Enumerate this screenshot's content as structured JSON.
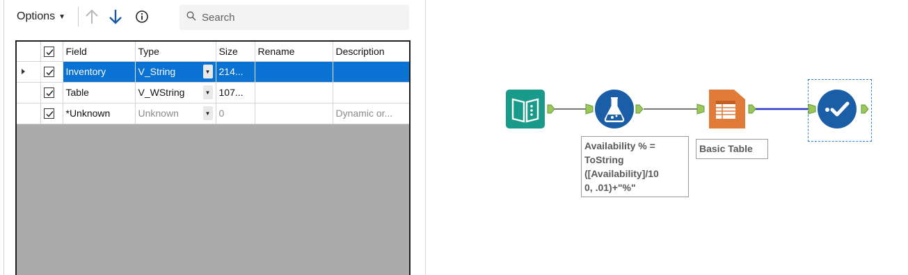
{
  "toolbar": {
    "options_label": "Options",
    "search_placeholder": "Search"
  },
  "grid": {
    "columns": [
      "Field",
      "Type",
      "Size",
      "Rename",
      "Description"
    ],
    "rows": [
      {
        "selected": true,
        "checked": true,
        "field": "Inventory",
        "type": "V_String",
        "size": "214...",
        "rename": "",
        "description": ""
      },
      {
        "selected": false,
        "checked": true,
        "field": "Table",
        "type": "V_WString",
        "size": "107...",
        "rename": "",
        "description": ""
      },
      {
        "selected": false,
        "checked": true,
        "field": "*Unknown",
        "type": "Unknown",
        "size": "0",
        "rename": "",
        "description": "Dynamic or..."
      }
    ]
  },
  "workflow": {
    "tools": [
      {
        "name": "input-data-tool",
        "icon": "book-icon",
        "color": "#1a9a8a"
      },
      {
        "name": "formula-tool",
        "icon": "flask-icon",
        "color": "#1b5ea8"
      },
      {
        "name": "basic-table-tool",
        "icon": "table-icon",
        "color": "#e07b39"
      },
      {
        "name": "render-tool",
        "icon": "checkmark-icon",
        "color": "#1b5ea8"
      }
    ],
    "annotations": {
      "formula_lines": [
        "Availability % =",
        "ToString",
        "([Availability]/10",
        "0, .01)+\"%\""
      ],
      "basic_table": "Basic Table"
    }
  },
  "colors": {
    "selection": "#0a72d3",
    "anchor": "#9ac75a",
    "connection": "#777777",
    "connection_selected": "#2b36c8"
  }
}
